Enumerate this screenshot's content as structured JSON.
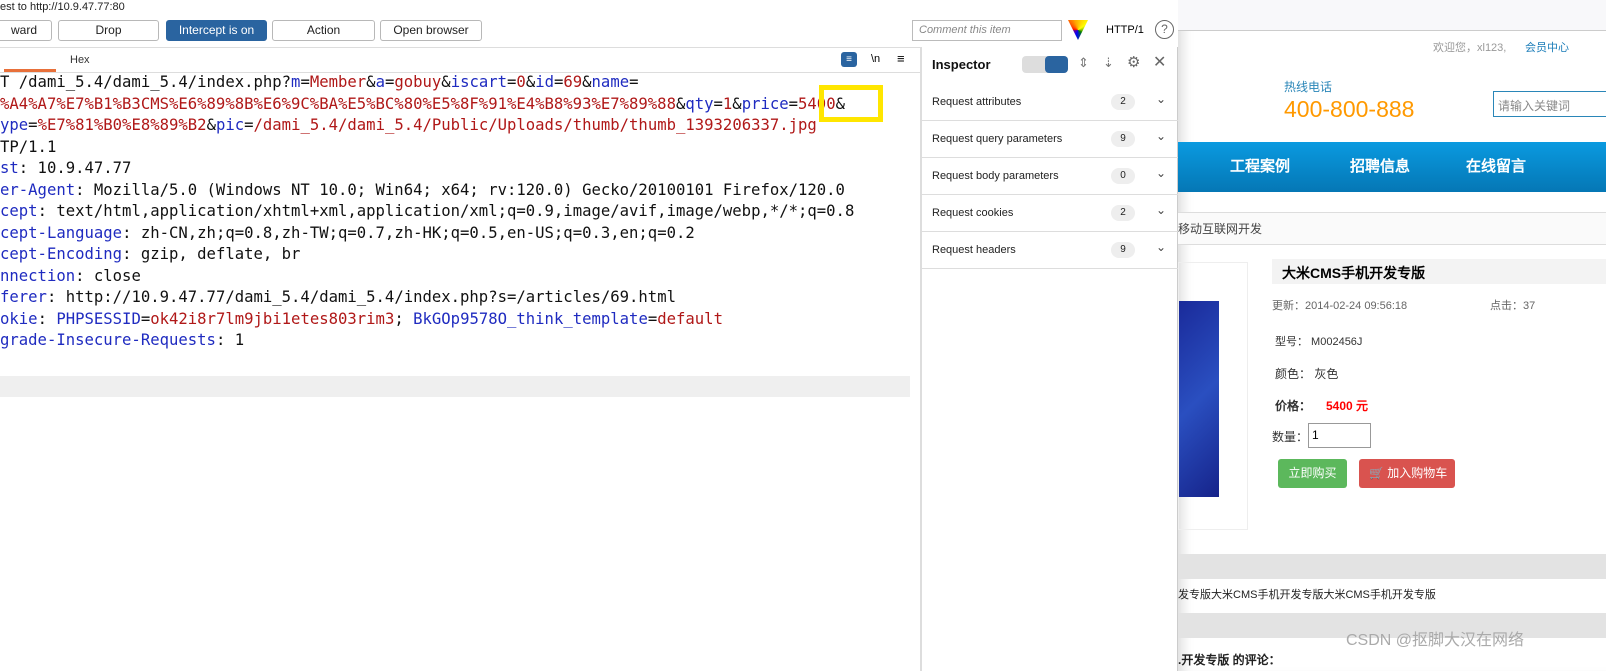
{
  "title": "est to http://10.9.47.77:80",
  "toolbar": {
    "forward": "ward",
    "drop": "Drop",
    "intercept": "Intercept is on",
    "action": "Action",
    "open_browser": "Open browser",
    "comment_placeholder": "Comment this item",
    "http_version": "HTTP/1"
  },
  "editor": {
    "tabs": {
      "raw": "",
      "hex": "Hex"
    },
    "newline_toggle": "\\n",
    "lines": [
      [
        [
          "T /dami_5.4/dami_5.4/index.php?",
          ""
        ],
        [
          "m",
          "k"
        ],
        [
          "=",
          ""
        ],
        [
          "Member",
          "v"
        ],
        [
          "&",
          ""
        ],
        [
          "a",
          "k"
        ],
        [
          "=",
          ""
        ],
        [
          "gobuy",
          "v"
        ],
        [
          "&",
          ""
        ],
        [
          "iscart",
          "k"
        ],
        [
          "=",
          ""
        ],
        [
          "0",
          "v"
        ],
        [
          "&",
          ""
        ],
        [
          "id",
          "k"
        ],
        [
          "=",
          ""
        ],
        [
          "69",
          "v"
        ],
        [
          "&",
          ""
        ],
        [
          "name",
          "k"
        ],
        [
          "=",
          ""
        ]
      ],
      [
        [
          "%A4%A7%E7%B1%B3CMS%E6%89%8B%E6%9C%BA%E5%BC%80%E5%8F%91%E4%B8%93%E7%89%88",
          "v"
        ],
        [
          "&",
          ""
        ],
        [
          "qty",
          "k"
        ],
        [
          "=",
          ""
        ],
        [
          "1",
          "v"
        ],
        [
          "&",
          ""
        ],
        [
          "price",
          "k"
        ],
        [
          "=",
          ""
        ],
        [
          "5400",
          "v"
        ],
        [
          "&",
          ""
        ]
      ],
      [
        [
          "ype",
          "k"
        ],
        [
          "=",
          ""
        ],
        [
          "%E7%81%B0%E8%89%B2",
          "v"
        ],
        [
          "&",
          ""
        ],
        [
          "pic",
          "k"
        ],
        [
          "=",
          ""
        ],
        [
          "/dami_5.4/dami_5.4/Public/Uploads/thumb/thumb_1393206337.jpg",
          "v"
        ]
      ],
      [
        [
          "TP/1.1",
          ""
        ]
      ],
      [
        [
          "st",
          "k"
        ],
        [
          ": 10.9.47.77",
          ""
        ]
      ],
      [
        [
          "er-Agent",
          "k"
        ],
        [
          ": Mozilla/5.0 (Windows NT 10.0; Win64; x64; rv:120.0) Gecko/20100101 Firefox/120.0",
          ""
        ]
      ],
      [
        [
          "cept",
          "k"
        ],
        [
          ": text/html,application/xhtml+xml,application/xml;q=0.9,image/avif,image/webp,*/*;q=0.8",
          ""
        ]
      ],
      [
        [
          "cept-Language",
          "k"
        ],
        [
          ": zh-CN,zh;q=0.8,zh-TW;q=0.7,zh-HK;q=0.5,en-US;q=0.3,en;q=0.2",
          ""
        ]
      ],
      [
        [
          "cept-Encoding",
          "k"
        ],
        [
          ": gzip, deflate, br",
          ""
        ]
      ],
      [
        [
          "nnection",
          "k"
        ],
        [
          ": close",
          ""
        ]
      ],
      [
        [
          "ferer",
          "k"
        ],
        [
          ": http://10.9.47.77/dami_5.4/dami_5.4/index.php?s=/articles/69.html",
          ""
        ]
      ],
      [
        [
          "okie",
          "k"
        ],
        [
          ": ",
          ""
        ],
        [
          "PHPSESSID",
          "k"
        ],
        [
          "=",
          ""
        ],
        [
          "ok42i8r7lm9jbi1etes803rim3",
          "v"
        ],
        [
          "; ",
          ""
        ],
        [
          "BkGOp9578O_think_template",
          "k"
        ],
        [
          "=",
          ""
        ],
        [
          "default",
          "v"
        ]
      ],
      [
        [
          "grade-Insecure-Requests",
          "k"
        ],
        [
          ": 1",
          ""
        ]
      ]
    ]
  },
  "inspector": {
    "title": "Inspector",
    "sections": [
      {
        "label": "Request attributes",
        "count": "2"
      },
      {
        "label": "Request query parameters",
        "count": "9"
      },
      {
        "label": "Request body parameters",
        "count": "0"
      },
      {
        "label": "Request cookies",
        "count": "2"
      },
      {
        "label": "Request headers",
        "count": "9"
      }
    ]
  },
  "site": {
    "welcome": "欢迎您，xl123,",
    "member_center": "会员中心",
    "hotline_label": "热线电话",
    "hotline": "400-800-888",
    "search_placeholder": "请输入关键词",
    "nav": [
      "工程案例",
      "招聘信息",
      "在线留言"
    ],
    "breadcrumb": "移动互联网开发",
    "product": {
      "name": "大米CMS手机开发专版",
      "updated": "更新：2014-02-24 09:56:18",
      "clicks": "点击：37",
      "model": "型号： M002456J",
      "color": "颜色： 灰色",
      "price_label": "价格：",
      "price": "5400 元",
      "qty_label": "数量：",
      "qty": "1",
      "buy": "立即购买",
      "cart": "加入购物车"
    },
    "description": "发专版大米CMS手机开发专版大米CMS手机开发专版",
    "comments": ".开发专版 的评论：",
    "watermark": "CSDN @抠脚大汉在网络"
  },
  "colors": {
    "intercept": "#2a64a0",
    "highlight": "#ffe600",
    "price": "#ff0000",
    "hotline": "#ff9900",
    "nav": "#0a8fd0"
  }
}
